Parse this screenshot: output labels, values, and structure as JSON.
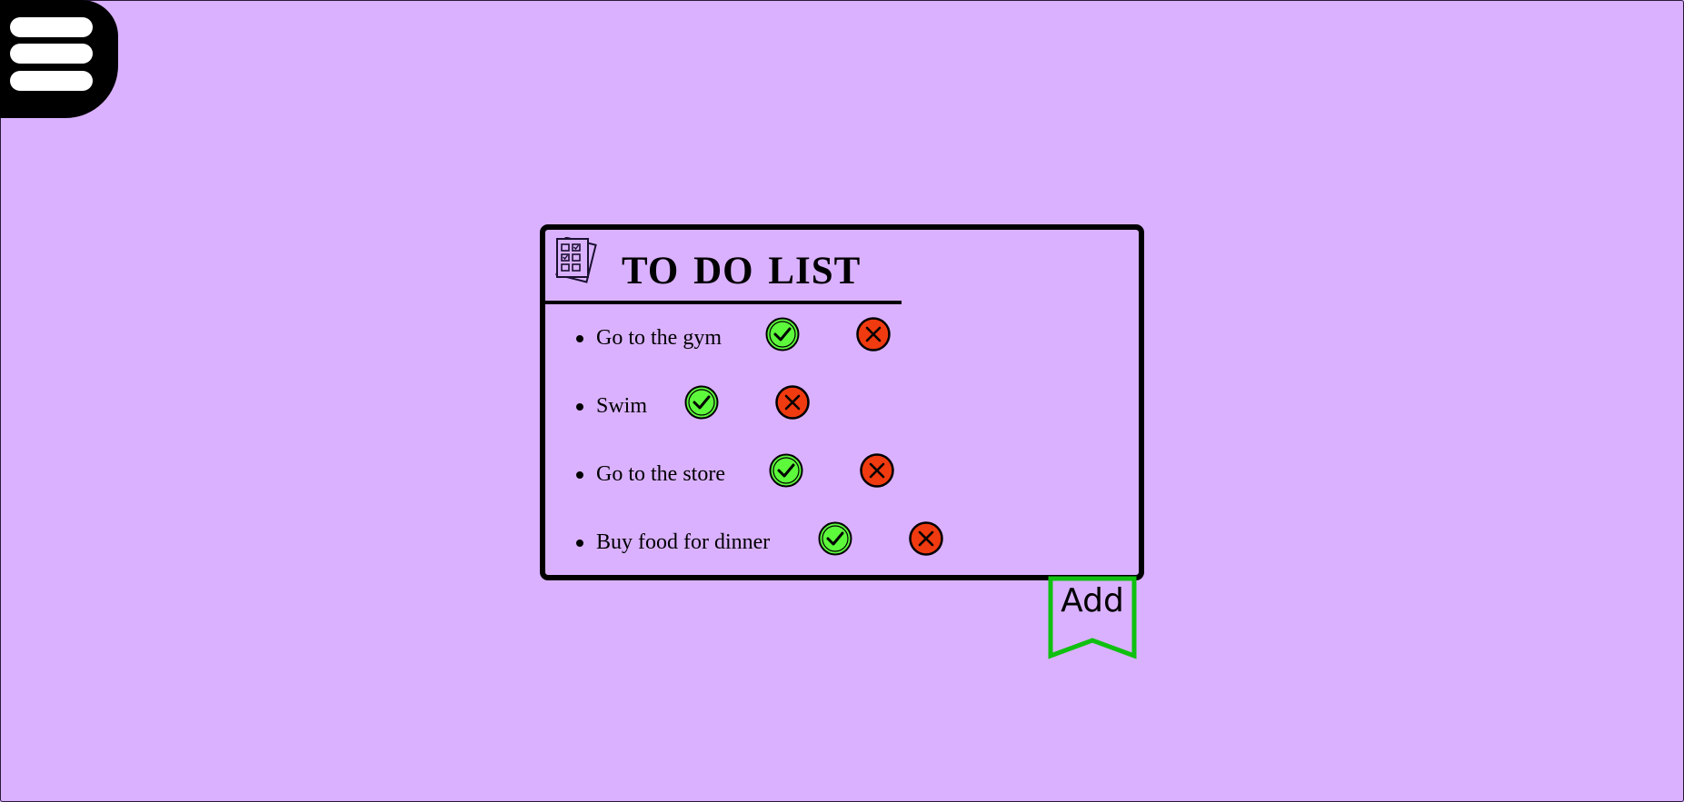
{
  "menu": {
    "icon": "hamburger-icon"
  },
  "todo": {
    "title": "TO DO LIST",
    "header_icon": "checklist-icon",
    "items": [
      {
        "text": "Go to the gym",
        "complete_icon": "check-circle-icon",
        "delete_icon": "x-circle-icon"
      },
      {
        "text": "Swim",
        "complete_icon": "check-circle-icon",
        "delete_icon": "x-circle-icon"
      },
      {
        "text": "Go to the store",
        "complete_icon": "check-circle-icon",
        "delete_icon": "x-circle-icon"
      },
      {
        "text": "Buy food for dinner",
        "complete_icon": "check-circle-icon",
        "delete_icon": "x-circle-icon"
      }
    ]
  },
  "add_button": {
    "label": "Add"
  },
  "colors": {
    "background": "#dab1ff",
    "complete": "#5dfa3c",
    "delete": "#f03a0f",
    "add_border": "#10c010"
  }
}
